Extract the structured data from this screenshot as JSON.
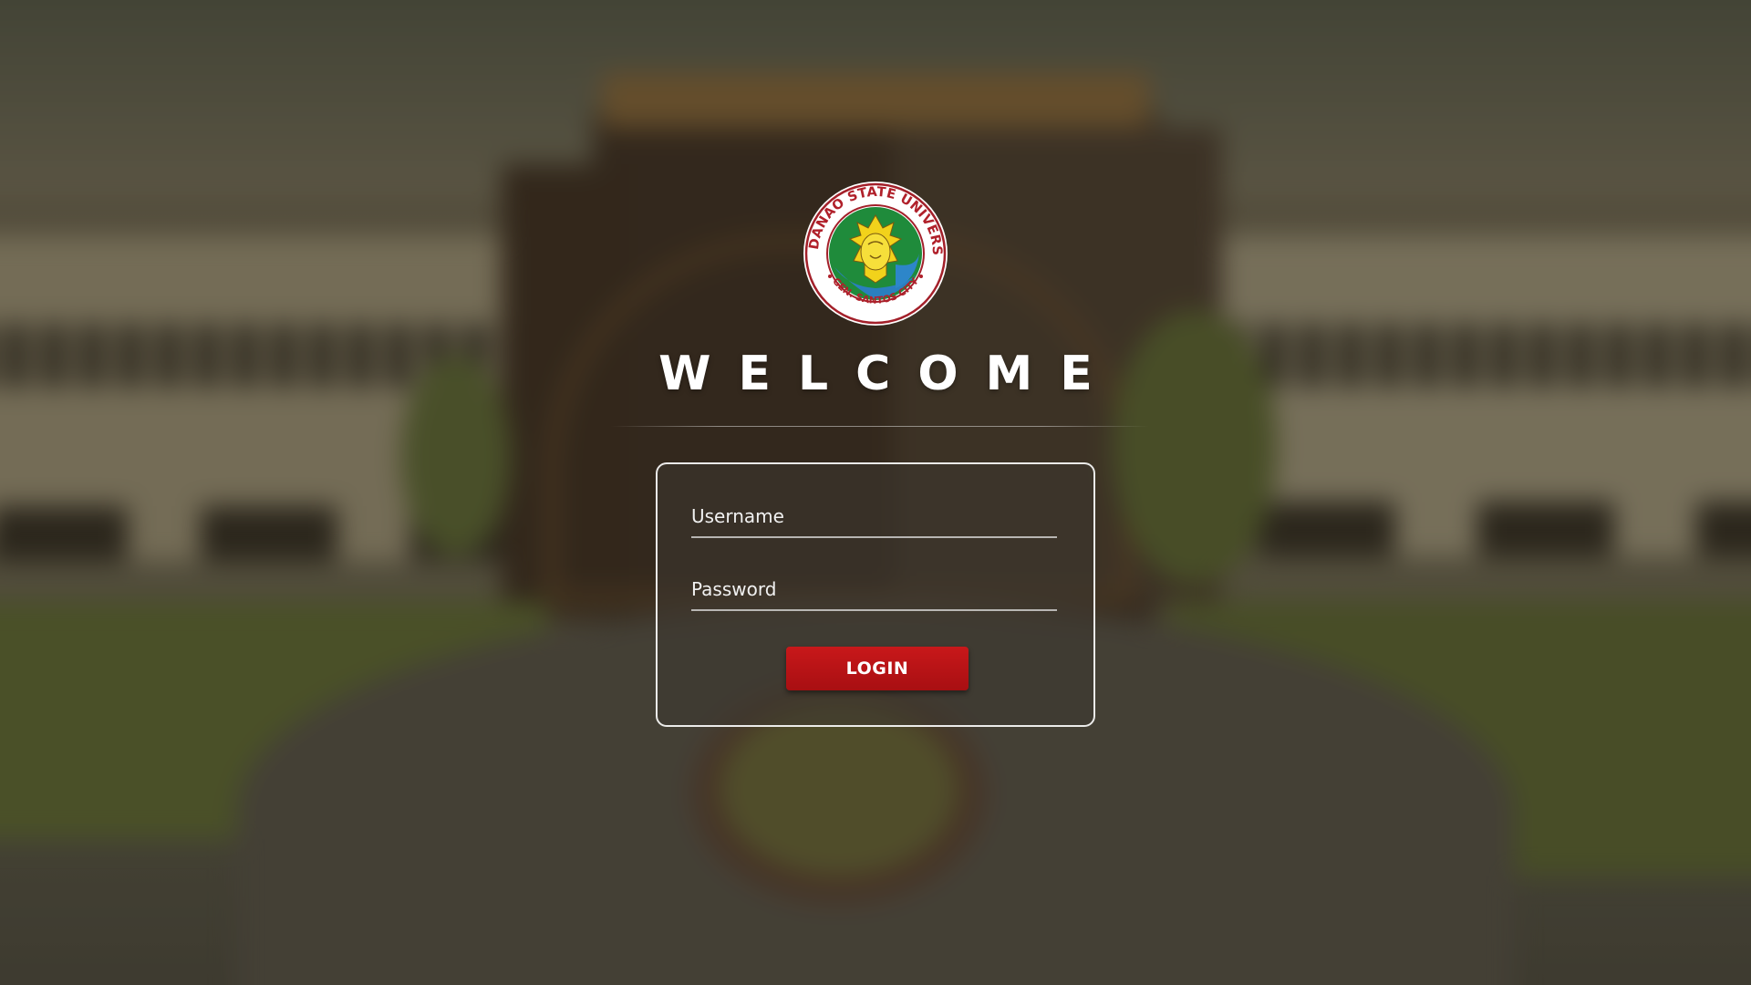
{
  "seal": {
    "top_text": "MINDANAO STATE UNIVERSITY",
    "bottom_text": "GEN. SANTOS CITY"
  },
  "heading": "WELCOME",
  "form": {
    "username_placeholder": "Username",
    "password_placeholder": "Password",
    "login_label": "LOGIN"
  },
  "colors": {
    "button": "#b81315",
    "seal_ring_text": "#b0202a",
    "seal_globe": "#1a8a3a",
    "seal_emblem": "#f2d21b"
  }
}
